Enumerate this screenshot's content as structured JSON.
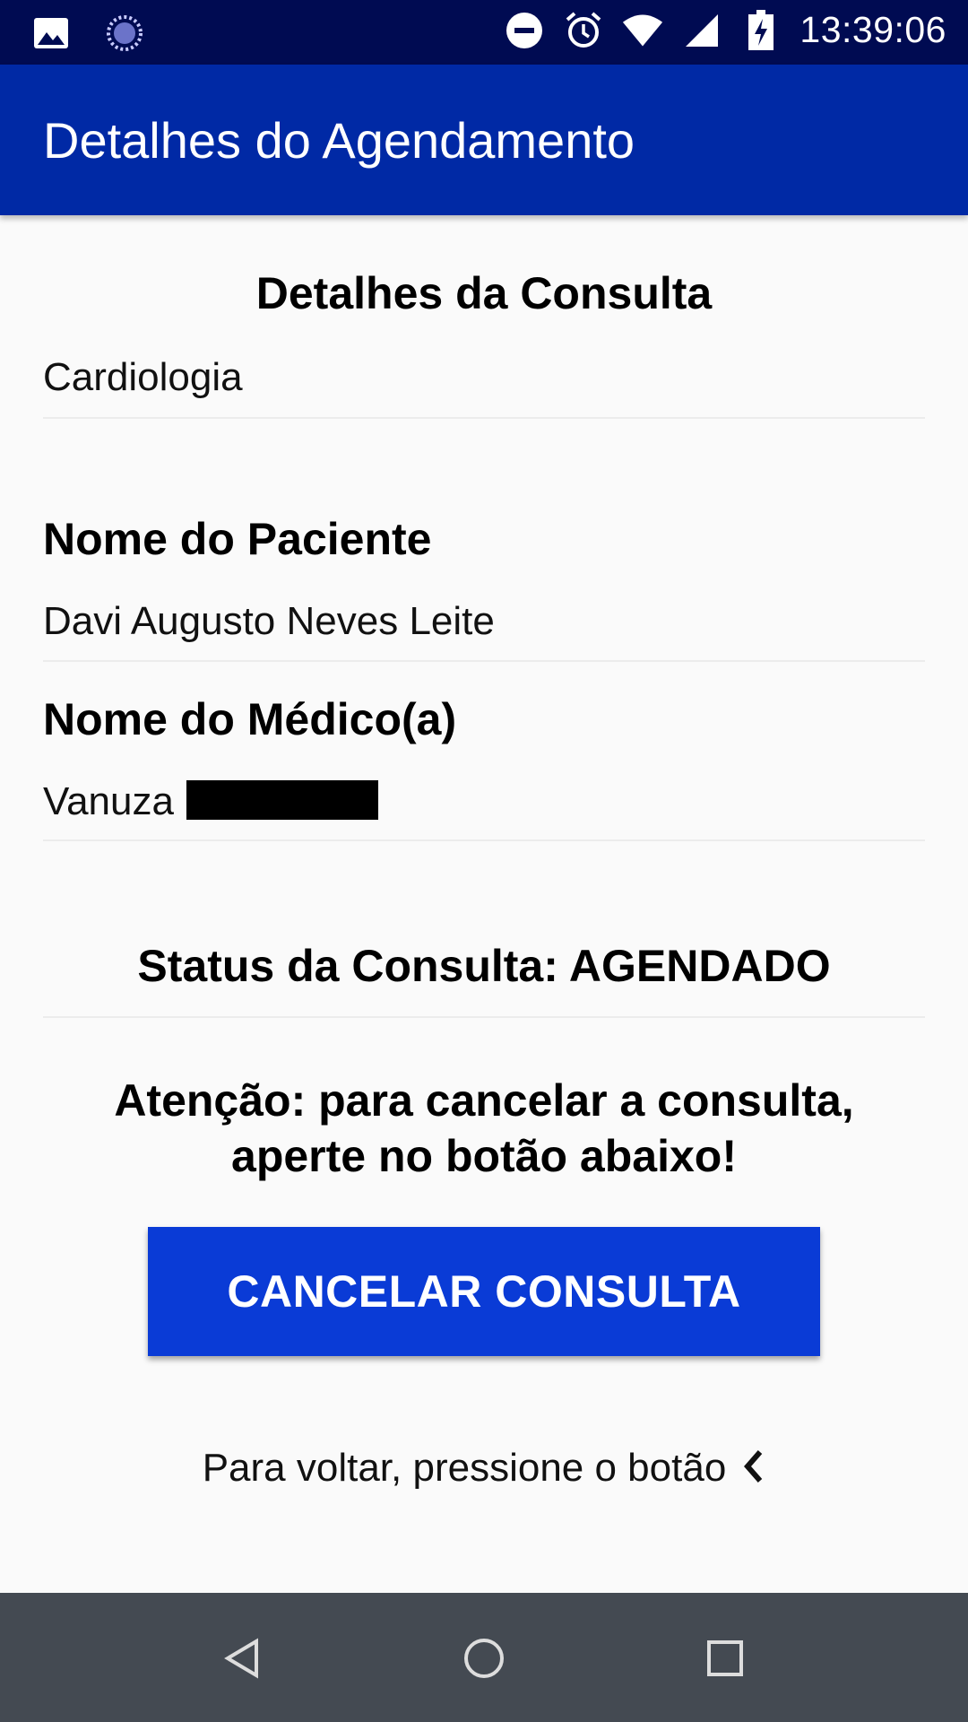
{
  "status_bar": {
    "time": "13:39:06",
    "icons": [
      "image-icon",
      "sync-icon",
      "do-not-disturb-icon",
      "alarm-icon",
      "wifi-icon",
      "signal-icon",
      "battery-charging-icon"
    ]
  },
  "app_bar": {
    "title": "Detalhes do Agendamento"
  },
  "consulta": {
    "heading": "Detalhes da Consulta",
    "specialty": "Cardiologia"
  },
  "paciente": {
    "label": "Nome do Paciente",
    "name": "Davi Augusto Neves Leite"
  },
  "medico": {
    "label": "Nome do Médico(a)",
    "name": "Vanuza"
  },
  "status": {
    "text": "Status da Consulta: AGENDADO"
  },
  "attention": {
    "line1": "Atenção: para cancelar a consulta,",
    "line2": "aperte no botão abaixo!"
  },
  "cancel_button": {
    "label": "CANCELAR CONSULTA"
  },
  "back_hint": {
    "text": "Para voltar, pressione o botão"
  },
  "colors": {
    "status_bar": "#000b52",
    "app_bar": "#0029a5",
    "button": "#0a3bd6",
    "nav_bar": "#444a52"
  }
}
